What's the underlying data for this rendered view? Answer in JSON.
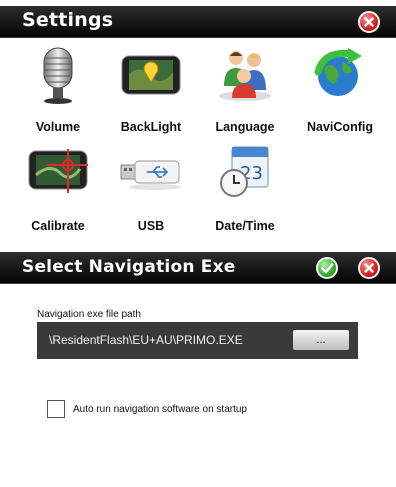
{
  "settings_window": {
    "title": "Settings",
    "tiles": [
      {
        "label": "Volume",
        "icon": "microphone-icon"
      },
      {
        "label": "BackLight",
        "icon": "backlight-screen-icon"
      },
      {
        "label": "Language",
        "icon": "language-people-icon"
      },
      {
        "label": "NaviConfig",
        "icon": "globe-arrow-icon"
      },
      {
        "label": "Calibrate",
        "icon": "calibrate-screen-icon"
      },
      {
        "label": "USB",
        "icon": "usb-drive-icon"
      },
      {
        "label": "Date/Time",
        "icon": "calendar-clock-icon"
      }
    ]
  },
  "navigation_window": {
    "title": "Select Navigation Exe",
    "path_label": "Navigation exe file path",
    "path_value": "\\ResidentFlash\\EU+AU\\PRIMO.EXE",
    "browse_label": "...",
    "autorun_label": "Auto run navigation software on startup",
    "autorun_checked": false
  },
  "colors": {
    "titlebar": "#0a0a0a",
    "close_button": "#d42020",
    "ok_button": "#34b02e",
    "path_box": "#3a3a3a"
  }
}
